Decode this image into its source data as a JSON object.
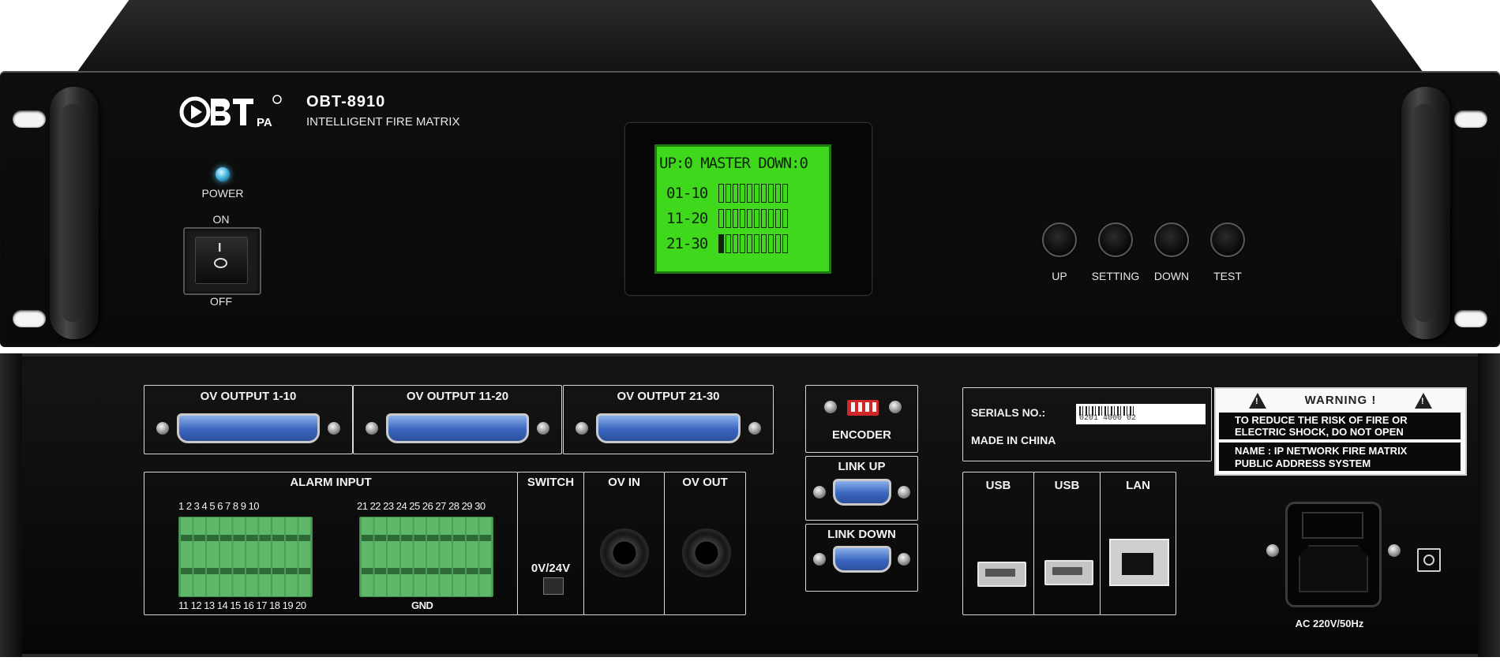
{
  "front": {
    "brand": "OBT",
    "brand_suffix": "PA",
    "model": "OBT-8910",
    "description": "INTELLIGENT FIRE MATRIX",
    "power_label": "POWER",
    "switch_on_label": "ON",
    "switch_off_label": "OFF",
    "rocker_on_mark": "I",
    "lcd": {
      "header": "UP:0 MASTER DOWN:0",
      "rows": [
        {
          "label": "01-10",
          "filled": 0,
          "cells": 10
        },
        {
          "label": "11-20",
          "filled": 0,
          "cells": 10
        },
        {
          "label": "21-30",
          "filled": 1,
          "cells": 10
        }
      ]
    },
    "buttons": [
      {
        "label": "UP"
      },
      {
        "label": "SETTING"
      },
      {
        "label": "DOWN"
      },
      {
        "label": "TEST"
      }
    ]
  },
  "rear": {
    "outputs": [
      "OV OUTPUT 1-10",
      "OV OUTPUT 11-20",
      "OV OUTPUT 21-30"
    ],
    "encoder_label": "ENCODER",
    "link_up_label": "LINK UP",
    "link_down_label": "LINK DOWN",
    "alarm_input_label": "ALARM INPUT",
    "alarm_top_left": "1 2 3 4 5 6 7 8 9 10",
    "alarm_bottom_left": "11 12 13 14 15 16 17 18 19 20",
    "alarm_top_right": "21 22 23 24 25 26 27 28 29 30",
    "alarm_bottom_right": "GND",
    "switch_label": "SWITCH",
    "switch_value": "0V/24V",
    "ov_in_label": "OV IN",
    "ov_out_label": "OV OUT",
    "serials_label": "SERIALS NO.:",
    "serial_value": "0201 4000   02",
    "made_in": "MADE IN CHINA",
    "warning_title": "WARNING !",
    "warning_line1": "TO REDUCE THE RISK OF FIRE OR",
    "warning_line2": "ELECTRIC SHOCK, DO NOT OPEN",
    "name_line1": "NAME : IP NETWORK FIRE MATRIX",
    "name_line2": "PUBLIC ADDRESS SYSTEM",
    "usb1_label": "USB",
    "usb2_label": "USB",
    "lan_label": "LAN",
    "power_rating": "AC 220V/50Hz"
  },
  "colors": {
    "lcd_green": "#3fd81d",
    "power_led": "#49b8e6",
    "terminal_green": "#5fb86a",
    "dsub_blue": "#3a66c0"
  }
}
